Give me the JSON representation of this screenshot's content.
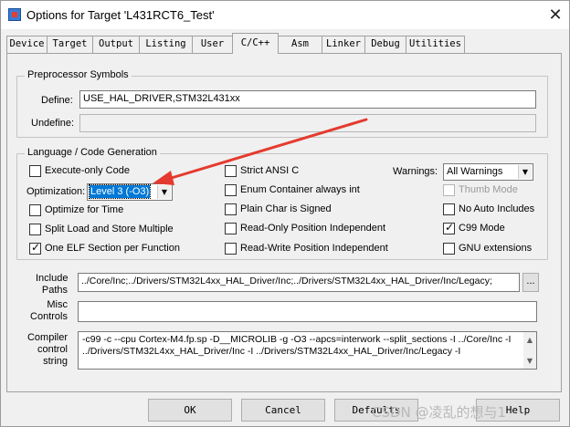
{
  "window": {
    "title": "Options for Target 'L431RCT6_Test'",
    "close_glyph": "✕"
  },
  "tabs": [
    {
      "label": "Device"
    },
    {
      "label": "Target"
    },
    {
      "label": "Output"
    },
    {
      "label": "Listing"
    },
    {
      "label": "User"
    },
    {
      "label": "C/C++"
    },
    {
      "label": "Asm"
    },
    {
      "label": "Linker"
    },
    {
      "label": "Debug"
    },
    {
      "label": "Utilities"
    }
  ],
  "active_tab": "C/C++",
  "preprocessor": {
    "group_label": "Preprocessor Symbols",
    "define_label": "Define:",
    "define_value": "USE_HAL_DRIVER,STM32L431xx",
    "undefine_label": "Undefine:",
    "undefine_value": ""
  },
  "language": {
    "group_label": "Language / Code Generation",
    "execute_only": {
      "label": "Execute-only Code",
      "checked": false
    },
    "optimization_label": "Optimization:",
    "optimization_value": "Level 3 (-O3)",
    "optimize_time": {
      "label": "Optimize for Time",
      "checked": false
    },
    "split_load": {
      "label": "Split Load and Store Multiple",
      "checked": false
    },
    "one_elf": {
      "label": "One ELF Section per Function",
      "checked": true
    },
    "strict_ansi": {
      "label": "Strict ANSI C",
      "checked": false
    },
    "enum_container": {
      "label": "Enum Container always int",
      "checked": false
    },
    "plain_char": {
      "label": "Plain Char is Signed",
      "checked": false
    },
    "ro_pi": {
      "label": "Read-Only Position Independent",
      "checked": false
    },
    "rw_pi": {
      "label": "Read-Write Position Independent",
      "checked": false
    },
    "warnings_label": "Warnings:",
    "warnings_value": "All Warnings",
    "thumb_mode": {
      "label": "Thumb Mode",
      "checked": false,
      "disabled": true
    },
    "no_auto_includes": {
      "label": "No Auto Includes",
      "checked": false
    },
    "c99_mode": {
      "label": "C99 Mode",
      "checked": true
    },
    "gnu_extensions": {
      "label": "GNU extensions",
      "checked": false
    }
  },
  "include_paths": {
    "label_line1": "Include",
    "label_line2": "Paths",
    "value": "../Core/Inc;../Drivers/STM32L4xx_HAL_Driver/Inc;../Drivers/STM32L4xx_HAL_Driver/Inc/Legacy;",
    "browse_label": "..."
  },
  "misc_controls": {
    "label_line1": "Misc",
    "label_line2": "Controls",
    "value": ""
  },
  "compiler_control": {
    "label_line1": "Compiler",
    "label_line2": "control",
    "label_line3": "string",
    "line1": "-c99 -c --cpu Cortex-M4.fp.sp -D__MICROLIB -g -O3 --apcs=interwork --split_sections -I ../Core/Inc -I",
    "line2": "../Drivers/STM32L4xx_HAL_Driver/Inc -I ../Drivers/STM32L4xx_HAL_Driver/Inc/Legacy -I"
  },
  "buttons": {
    "ok": "OK",
    "cancel": "Cancel",
    "defaults": "Defaults",
    "help": "Help"
  },
  "watermark": "CSDN @凌乱的想与1",
  "colors": {
    "annotation_arrow": "#e53a2f",
    "selection": "#0078d7"
  }
}
